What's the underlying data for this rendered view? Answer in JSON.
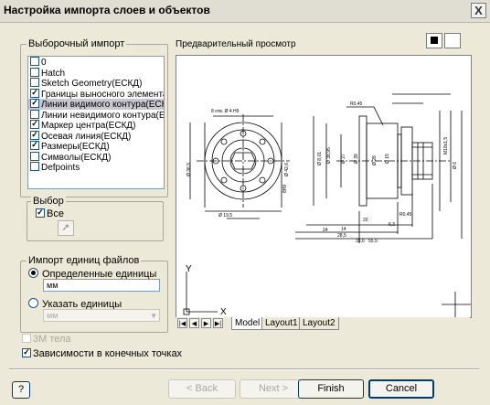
{
  "window": {
    "title": "Настройка импорта слоев и объектов",
    "close_glyph": "X"
  },
  "selective_import": {
    "label": "Выборочный импорт",
    "items": [
      {
        "label": "0",
        "checked": false,
        "selected": false
      },
      {
        "label": "Hatch",
        "checked": false,
        "selected": false
      },
      {
        "label": "Sketch Geometry(ЕСКД)",
        "checked": false,
        "selected": false
      },
      {
        "label": "Границы выносного элемента(ЕСК",
        "checked": true,
        "selected": false
      },
      {
        "label": "Линии видимого контура(ЕСКД)",
        "checked": true,
        "selected": true
      },
      {
        "label": "Линии невидимого контура(ЕСКД)",
        "checked": false,
        "selected": false
      },
      {
        "label": "Маркер центра(ЕСКД)",
        "checked": true,
        "selected": false
      },
      {
        "label": "Осевая линия(ЕСКД)",
        "checked": true,
        "selected": false
      },
      {
        "label": "Размеры(ЕСКД)",
        "checked": true,
        "selected": false
      },
      {
        "label": "Символы(ЕСКД)",
        "checked": false,
        "selected": false
      },
      {
        "label": "Defpoints",
        "checked": false,
        "selected": false
      }
    ]
  },
  "selection": {
    "label": "Выбор",
    "all_label": "Все",
    "all_checked": true
  },
  "units": {
    "label": "Импорт единиц файлов",
    "defined_label": "Определенные единицы",
    "defined_value": "мм",
    "specify_label": "Указать единицы",
    "specify_value": "мм"
  },
  "options": {
    "solid_3d_label": "3М тела",
    "endpoint_constraints_label": "Зависимости в конечных точках"
  },
  "preview": {
    "label": "Предварительный просмотр",
    "tabs": [
      "Model",
      "Layout1",
      "Layout2"
    ],
    "axis_x": "X",
    "axis_y": "Y",
    "drawing_dims": [
      "8 отв. Ø 4 Н9",
      "Ø 36,5",
      "Ø 19,5",
      "Ø 42,6",
      "8Н9",
      "Ø 8,01",
      "Ø 38,95",
      "Ø 27",
      "Ø 39",
      "Ø 28",
      "Ø 15",
      "М18x1,5",
      "Ø 6",
      "R0,45",
      "R0,45",
      "20",
      "6,3",
      "24",
      "14",
      "28,5",
      "33,6",
      "55,5"
    ]
  },
  "buttons": {
    "help": "?",
    "back": "< Back",
    "next": "Next >",
    "finish": "Finish",
    "cancel": "Cancel"
  },
  "colors": {
    "window_bg": "#ece9d8",
    "title_bg": "#e0ddd2",
    "drawing_line": "#000000"
  }
}
